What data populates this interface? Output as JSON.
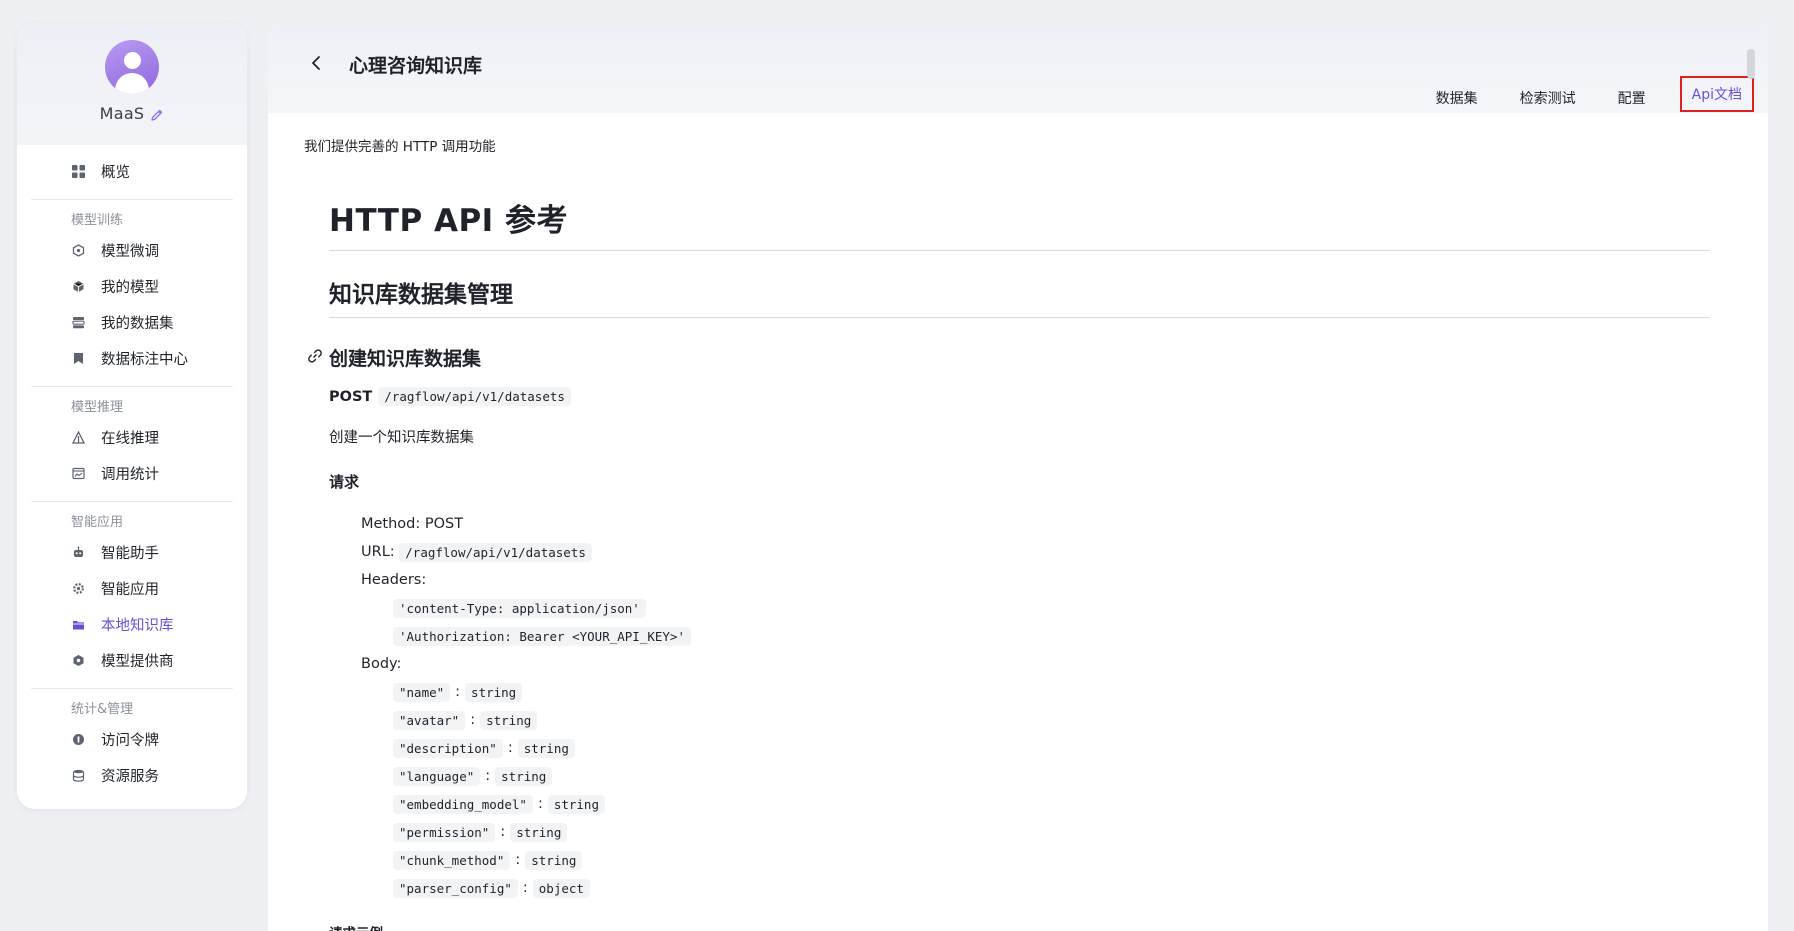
{
  "sidebar": {
    "profile_name": "MaaS",
    "items": {
      "overview": "概览",
      "group_training": "模型训练",
      "finetune": "模型微调",
      "my_models": "我的模型",
      "my_datasets": "我的数据集",
      "annotation": "数据标注中心",
      "group_inference": "模型推理",
      "online_inference": "在线推理",
      "usage_stats": "调用统计",
      "group_apps": "智能应用",
      "assistant": "智能助手",
      "smart_apps": "智能应用",
      "local_kb": "本地知识库",
      "providers": "模型提供商",
      "group_manage": "统计&管理",
      "access_token": "访问令牌",
      "resources": "资源服务"
    },
    "active": "local_kb",
    "accent_color": "#6a4fdc"
  },
  "header": {
    "title": "心理咨询知识库",
    "tabs": [
      "数据集",
      "检索测试",
      "配置",
      "Api文档"
    ],
    "active_tab": "Api文档"
  },
  "content": {
    "sub_desc": "我们提供完善的 HTTP 调用功能",
    "h1": "HTTP API 参考",
    "h2": "知识库数据集管理",
    "h3": "创建知识库数据集",
    "method": "POST",
    "endpoint": "/ragflow/api/v1/datasets",
    "description": "创建一个知识库数据集",
    "request_heading": "请求",
    "method_line": "Method: POST",
    "url_label": "URL:",
    "url_value": "/ragflow/api/v1/datasets",
    "headers_label": "Headers:",
    "headers": [
      "'content-Type: application/json'",
      "'Authorization: Bearer <YOUR_API_KEY>'"
    ],
    "body_label": "Body:",
    "body_fields": [
      {
        "key": "\"name\"",
        "type": "string"
      },
      {
        "key": "\"avatar\"",
        "type": "string"
      },
      {
        "key": "\"description\"",
        "type": "string"
      },
      {
        "key": "\"language\"",
        "type": "string"
      },
      {
        "key": "\"embedding_model\"",
        "type": "string"
      },
      {
        "key": "\"permission\"",
        "type": "string"
      },
      {
        "key": "\"chunk_method\"",
        "type": "string"
      },
      {
        "key": "\"parser_config\"",
        "type": "object"
      }
    ],
    "example_heading": "请求示例"
  }
}
